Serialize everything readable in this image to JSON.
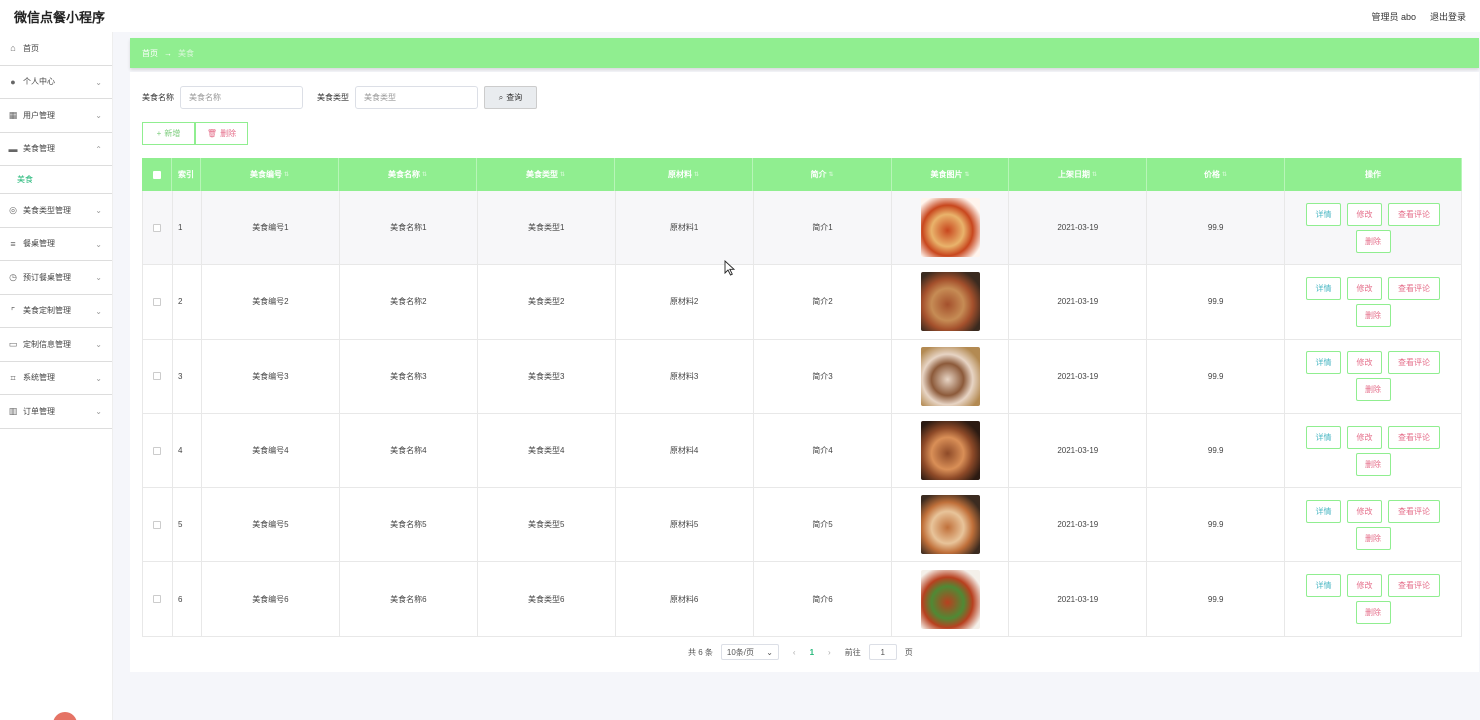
{
  "app": {
    "title": "微信点餐小程序",
    "admin_label": "管理员 abo",
    "logout": "退出登录"
  },
  "sidebar": {
    "items": [
      {
        "label": "首页",
        "icon": "home-icon",
        "glyph": "⌂",
        "chev": ""
      },
      {
        "label": "个人中心",
        "icon": "user-icon",
        "glyph": "●",
        "chev": "⌄"
      },
      {
        "label": "用户管理",
        "icon": "users-icon",
        "glyph": "▦",
        "chev": "⌄"
      },
      {
        "label": "美食管理",
        "icon": "chat-icon",
        "glyph": "▬",
        "chev": "⌃"
      },
      {
        "label": "美食类型管理",
        "icon": "compass-icon",
        "glyph": "◎",
        "chev": "⌄"
      },
      {
        "label": "餐桌管理",
        "icon": "sliders-icon",
        "glyph": "≡",
        "chev": "⌄"
      },
      {
        "label": "预订餐桌管理",
        "icon": "clock-icon",
        "glyph": "◷",
        "chev": "⌄"
      },
      {
        "label": "美食定制管理",
        "icon": "frame-icon",
        "glyph": "⌜",
        "chev": "⌄"
      },
      {
        "label": "定制信息管理",
        "icon": "ticket-icon",
        "glyph": "▭",
        "chev": "⌄"
      },
      {
        "label": "系统管理",
        "icon": "crop-icon",
        "glyph": "⌗",
        "chev": "⌄"
      },
      {
        "label": "订单管理",
        "icon": "bar-chart-icon",
        "glyph": "▥",
        "chev": "⌄"
      }
    ],
    "sub_active": "美食"
  },
  "breadcrumb": {
    "home": "首页",
    "sep": "→",
    "current": "美食"
  },
  "search": {
    "name_label": "美食名称",
    "name_placeholder": "美食名称",
    "type_label": "美食类型",
    "type_placeholder": "美食类型",
    "query_button": "查询"
  },
  "actions": {
    "add": "新增",
    "delete": "删除"
  },
  "table": {
    "headers": [
      "索引",
      "美食编号",
      "美食名称",
      "美食类型",
      "原材料",
      "简介",
      "美食图片",
      "上架日期",
      "价格",
      "操作"
    ],
    "rows": [
      {
        "index": "1",
        "code": "美食编号1",
        "name": "美食名称1",
        "type": "美食类型1",
        "material": "原材料1",
        "intro": "简介1",
        "date": "2021-03-19",
        "price": "99.9",
        "img_colors": [
          "#fff5ee",
          "#c8471e",
          "#e9b36b"
        ]
      },
      {
        "index": "2",
        "code": "美食编号2",
        "name": "美食名称2",
        "type": "美食类型2",
        "material": "原材料2",
        "intro": "简介2",
        "date": "2021-03-19",
        "price": "99.9",
        "img_colors": [
          "#3a2a1f",
          "#a4502c",
          "#c68c55"
        ]
      },
      {
        "index": "3",
        "code": "美食编号3",
        "name": "美食名称3",
        "type": "美食类型3",
        "material": "原材料3",
        "intro": "简介3",
        "date": "2021-03-19",
        "price": "99.9",
        "img_colors": [
          "#b38a52",
          "#e7d4c4",
          "#8c5a3a"
        ]
      },
      {
        "index": "4",
        "code": "美食编号4",
        "name": "美食名称4",
        "type": "美食类型4",
        "material": "原材料4",
        "intro": "简介4",
        "date": "2021-03-19",
        "price": "99.9",
        "img_colors": [
          "#2b1a12",
          "#8e4a28",
          "#d98f57"
        ]
      },
      {
        "index": "5",
        "code": "美食编号5",
        "name": "美食名称5",
        "type": "美食类型5",
        "material": "原材料5",
        "intro": "简介5",
        "date": "2021-03-19",
        "price": "99.9",
        "img_colors": [
          "#3b2b20",
          "#c0703a",
          "#e8c49a"
        ]
      },
      {
        "index": "6",
        "code": "美食编号6",
        "name": "美食名称6",
        "type": "美食类型6",
        "material": "原材料6",
        "intro": "简介6",
        "date": "2021-03-19",
        "price": "99.9",
        "img_colors": [
          "#f4f0ea",
          "#b8401f",
          "#4f8a35"
        ]
      }
    ],
    "ops": {
      "detail": "详情",
      "edit": "修改",
      "review": "查看评论",
      "delete": "删除"
    }
  },
  "pagination": {
    "total": "共 6 条",
    "page_size": "10条/页",
    "current": "1",
    "goto_label": "前往",
    "goto_value": "1",
    "page_suffix": "页"
  },
  "colors": {
    "accent": "#90ee90",
    "link_green": "#25b87a",
    "danger": "#e56e8a",
    "info": "#4db8c4"
  }
}
